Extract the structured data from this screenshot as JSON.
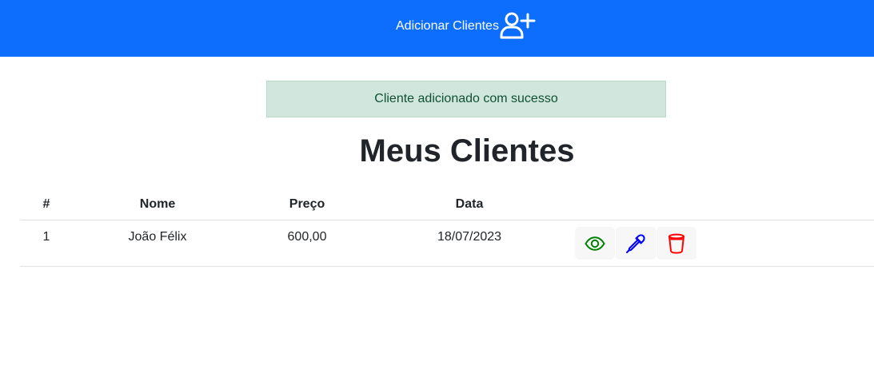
{
  "navbar": {
    "add_clients_label": "Adicionar Clientes",
    "add_clients_icon": "person-plus-icon",
    "background_color": "#0d6efd"
  },
  "alert": {
    "message": "Cliente adicionado com sucesso",
    "type": "success"
  },
  "page": {
    "title": "Meus Clientes"
  },
  "table": {
    "headers": {
      "id": "#",
      "nome": "Nome",
      "preco": "Preço",
      "data": "Data"
    },
    "rows": [
      {
        "id": "1",
        "nome": "João Félix",
        "preco": "600,00",
        "data": "18/07/2023",
        "actions": [
          {
            "icon": "eye-icon",
            "color": "#008000"
          },
          {
            "icon": "eyedropper-icon",
            "color": "#0000ff"
          },
          {
            "icon": "cup-icon",
            "color": "#ff0000"
          }
        ]
      }
    ]
  }
}
